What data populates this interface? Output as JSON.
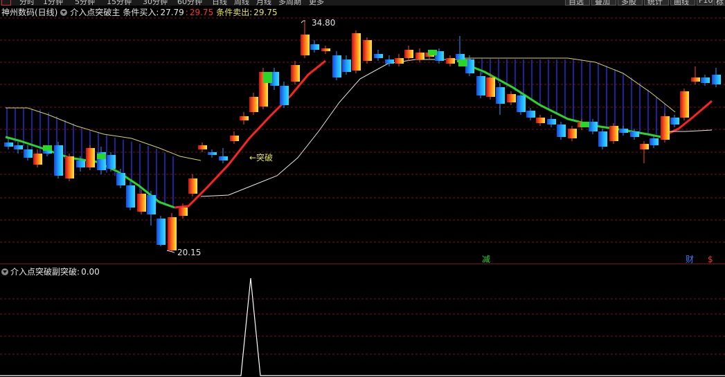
{
  "topbar": {
    "items": [
      "分时",
      "1分钟",
      "5分钟",
      "15分钟",
      "30分钟",
      "60分钟",
      "日线",
      "周线",
      "月线",
      "多周期",
      "更多"
    ],
    "right_items": [
      "自选",
      "叠加",
      "多股",
      "统计",
      "画线",
      "F10",
      "标"
    ]
  },
  "main_title": {
    "stock_name": "神州数码(日线)",
    "indicator": "介入点突破主",
    "buy_label": "条件买入:",
    "buy_value": "27.79",
    "mid_value": "29.75",
    "sell_label": "条件卖出:",
    "sell_value": "29.75"
  },
  "annotations": {
    "high_label": "34.80",
    "low_label": "20.15",
    "breakout_label": "←突破",
    "event_reduce": "减",
    "event_finance": "财",
    "event_dollar": "$"
  },
  "sub_title": {
    "indicator": "介入点突破副",
    "label": "突破:",
    "value": "0.00"
  },
  "colors": {
    "up": "#e0301e",
    "down": "#1a7fe0",
    "green_line": "#2bd62b",
    "red_line": "#ff2222",
    "white_line": "#e8e8e8",
    "yellow_band": "#d8d84a",
    "grid": "#7a1010",
    "blue_bars": "#2a2ad0"
  },
  "chart_data": {
    "type": "candlestick",
    "price_range": [
      19.5,
      36.5
    ],
    "high": 34.8,
    "low": 20.15,
    "candles_count": 70,
    "lines": [
      "green_trend",
      "red_trend",
      "white_ma",
      "yellow_band"
    ],
    "sub_chart": {
      "type": "line",
      "label": "突破",
      "values_peak": 1,
      "baseline": 0
    }
  }
}
